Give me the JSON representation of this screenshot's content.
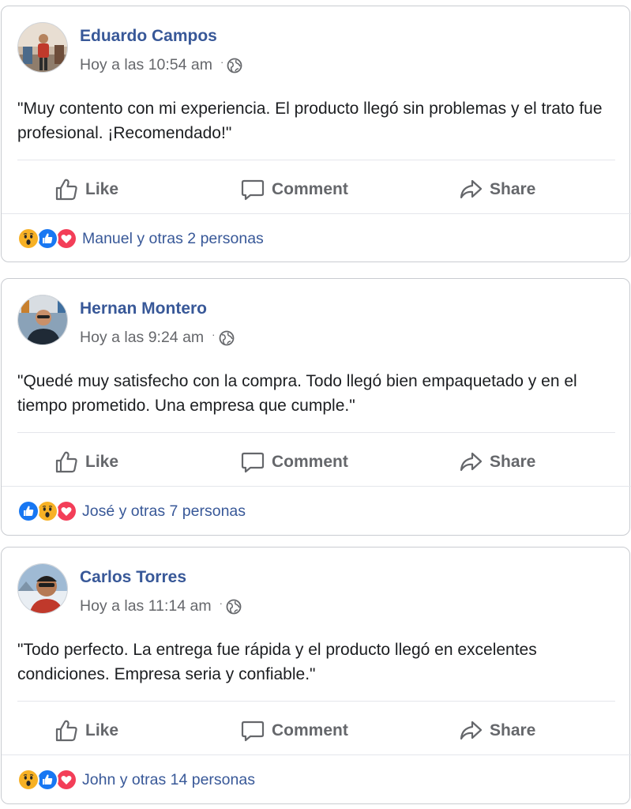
{
  "colors": {
    "name_blue": "#385898",
    "meta_gray": "#65676b",
    "text": "#1c1e21",
    "like_blue": "#1877f2",
    "love_red": "#f33e58",
    "wow_yellow": "#f7b125"
  },
  "posts": [
    {
      "author": "Eduardo Campos",
      "timestamp": "Hoy a las 10:54 am",
      "privacy_icon": "globe-icon",
      "text": "\"Muy contento con mi experiencia. El producto llegó sin problemas y el trato fue profesional. ¡Recomendado!\"",
      "actions": {
        "like": "Like",
        "comment": "Comment",
        "share": "Share"
      },
      "reaction_icons": [
        "wow-icon",
        "like-icon",
        "love-icon"
      ],
      "reactions_text": "Manuel y otras 2 personas"
    },
    {
      "author": "Hernan Montero",
      "timestamp": "Hoy a las 9:24 am",
      "privacy_icon": "globe-icon",
      "text": "\"Quedé muy satisfecho con la compra. Todo llegó bien empaquetado y en el tiempo prometido. Una empresa que cumple.\"",
      "actions": {
        "like": "Like",
        "comment": "Comment",
        "share": "Share"
      },
      "reaction_icons": [
        "like-icon",
        "wow-icon",
        "love-icon"
      ],
      "reactions_text": "José y otras 7 personas"
    },
    {
      "author": "Carlos Torres",
      "timestamp": "Hoy a las 11:14 am",
      "privacy_icon": "globe-icon",
      "text": "\"Todo perfecto. La entrega fue rápida y el producto llegó en excelentes condiciones. Empresa seria y confiable.\"",
      "actions": {
        "like": "Like",
        "comment": "Comment",
        "share": "Share"
      },
      "reaction_icons": [
        "wow-icon",
        "like-icon",
        "love-icon"
      ],
      "reactions_text": "John y otras 14 personas"
    }
  ]
}
